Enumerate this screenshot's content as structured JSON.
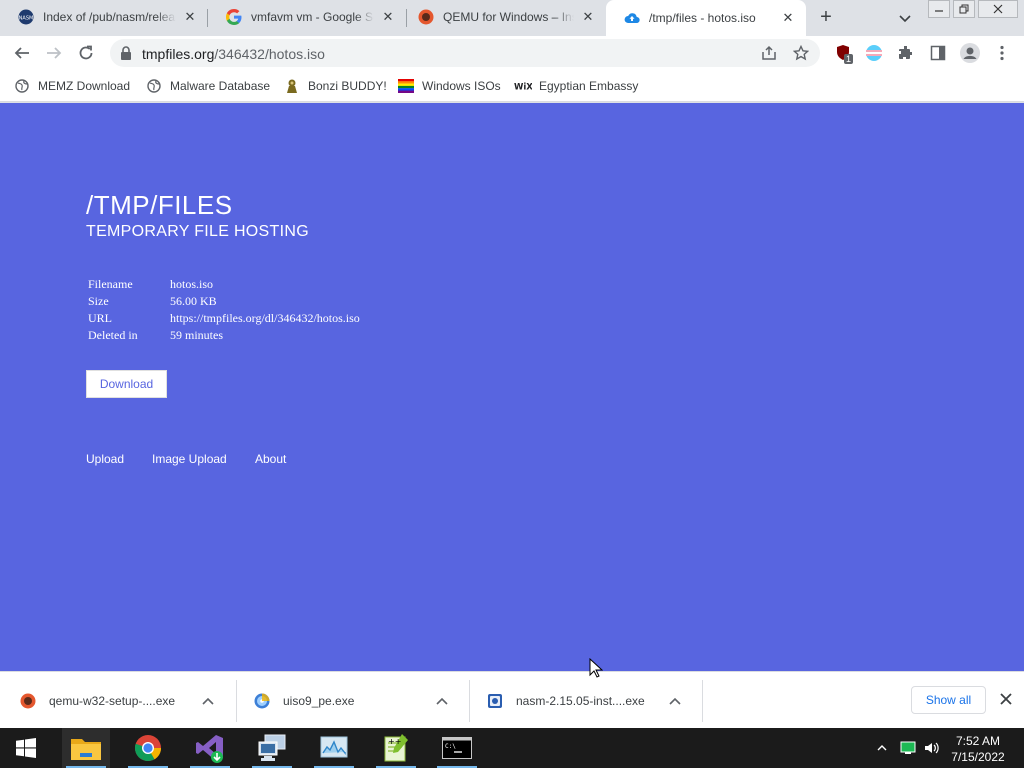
{
  "browser": {
    "tabs": [
      {
        "title": "Index of /pub/nasm/releases",
        "icon": "nasm-favicon"
      },
      {
        "title": "vmfavm vm - Google Search",
        "icon": "google-favicon"
      },
      {
        "title": "QEMU for Windows – Installers",
        "icon": "qemu-favicon"
      },
      {
        "title": "/tmp/files - hotos.iso",
        "icon": "tmpfiles-favicon",
        "active": true
      }
    ],
    "url_host": "tmpfiles.org",
    "url_path": "/346432/hotos.iso",
    "extension_badge": "1",
    "bookmarks": [
      {
        "label": "MEMZ Download",
        "icon": "globe-icon"
      },
      {
        "label": "Malware Database",
        "icon": "globe-icon"
      },
      {
        "label": "Bonzi BUDDY!",
        "icon": "bonzi-icon"
      },
      {
        "label": "Windows ISOs",
        "icon": "rainbow-flag-icon"
      },
      {
        "label": "Egyptian Embassy",
        "icon": "wix-icon"
      }
    ]
  },
  "page": {
    "title": "/TMP/FILES",
    "subtitle": "TEMPORARY FILE HOSTING",
    "info": [
      {
        "key": "Filename",
        "value": "hotos.iso"
      },
      {
        "key": "Size",
        "value": "56.00 KB"
      },
      {
        "key": "URL",
        "value": "https://tmpfiles.org/dl/346432/hotos.iso"
      },
      {
        "key": "Deleted in",
        "value": "59 minutes"
      }
    ],
    "download_label": "Download",
    "footer_links": [
      "Upload",
      "Image Upload",
      "About"
    ]
  },
  "downloads": {
    "items": [
      {
        "name": "qemu-w32-setup-....exe",
        "icon": "qemu-icon"
      },
      {
        "name": "uiso9_pe.exe",
        "icon": "ultraiso-icon"
      },
      {
        "name": "nasm-2.15.05-inst....exe",
        "icon": "installer-icon"
      }
    ],
    "show_all_label": "Show all"
  },
  "taskbar": {
    "time": "7:52 AM",
    "date": "7/15/2022"
  },
  "colors": {
    "page_bg": "#5865e0",
    "link": "#1a73e8",
    "taskbar": "#1b1b1b"
  }
}
